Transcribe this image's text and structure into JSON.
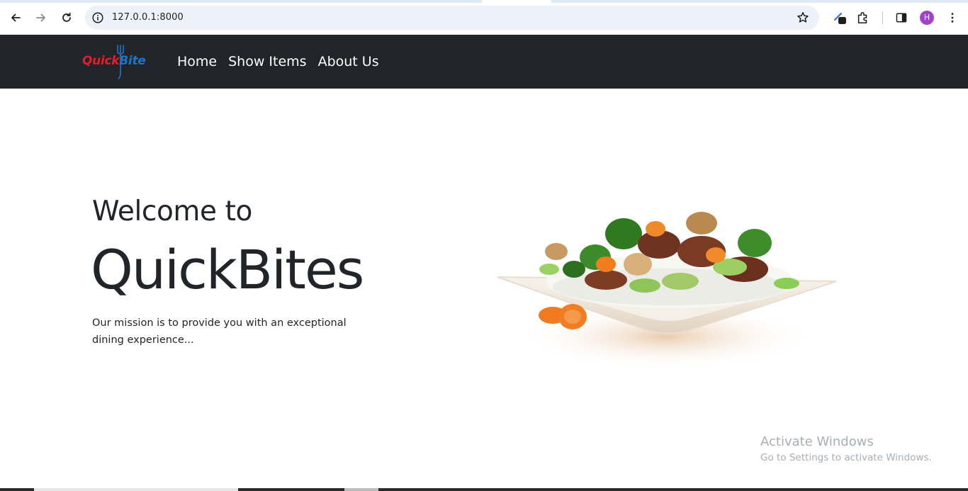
{
  "browser": {
    "url": "127.0.0.1:8000",
    "profile_initial": "H",
    "icons": [
      "back-icon",
      "forward-icon",
      "reload-icon",
      "site-info-icon",
      "bookmark-star-icon",
      "extension-pen-icon",
      "puzzle-extensions-icon",
      "side-panel-icon",
      "kebab-menu-icon"
    ]
  },
  "navbar": {
    "logo": {
      "part1": "Quick",
      "part2": "Bite"
    },
    "links": [
      "Home",
      "Show Items",
      "About Us"
    ]
  },
  "hero": {
    "subtitle": "Welcome to",
    "title": "QuickBites",
    "text": "Our mission is to provide you with an exceptional dining experience..."
  },
  "watermark": {
    "title": "Activate Windows",
    "subtitle": "Go to Settings to activate Windows."
  },
  "colors": {
    "navbar_bg": "#212529",
    "logo_red": "#e41e2b",
    "logo_blue": "#1f74c7",
    "text_dark": "#212529",
    "avatar_bg": "#a142c9"
  }
}
